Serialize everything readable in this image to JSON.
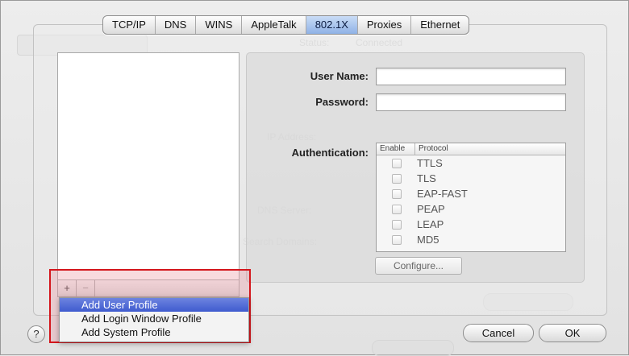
{
  "tabs": [
    "TCP/IP",
    "DNS",
    "WINS",
    "AppleTalk",
    "802.1X",
    "Proxies",
    "Ethernet"
  ],
  "active_tab": "802.1X",
  "form": {
    "user_name_label": "User Name:",
    "user_name_value": "",
    "password_label": "Password:",
    "password_value": "",
    "authentication_label": "Authentication:"
  },
  "protocols": {
    "header_enable": "Enable",
    "header_protocol": "Protocol",
    "items": [
      "TTLS",
      "TLS",
      "EAP-FAST",
      "PEAP",
      "LEAP",
      "MD5"
    ]
  },
  "configure_label": "Configure...",
  "list_toolbar": {
    "add": "+",
    "remove": "−"
  },
  "menu": {
    "items": [
      "Add User Profile",
      "Add Login Window Profile",
      "Add System Profile"
    ],
    "selected": "Add User Profile"
  },
  "buttons": {
    "cancel": "Cancel",
    "ok": "OK",
    "help": "?"
  },
  "colors": {
    "selection": "#3f5bcf",
    "highlight_border": "#d4161c"
  }
}
